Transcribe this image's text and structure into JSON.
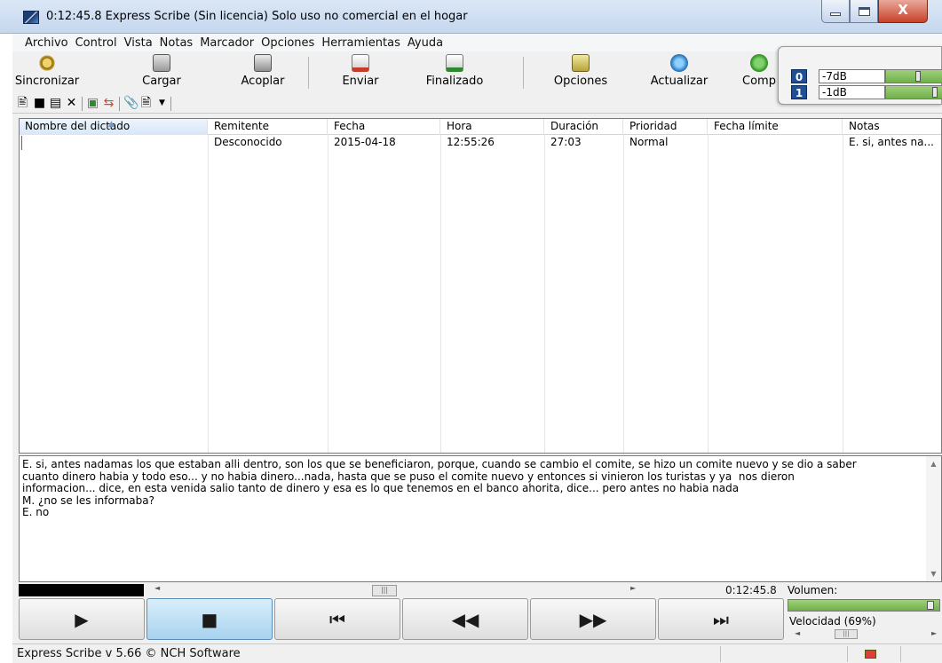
{
  "window": {
    "title": "0:12:45.8 Express Scribe (Sin licencia) Solo uso no comercial en el hogar",
    "close_glyph": "X"
  },
  "menu": [
    "Archivo",
    "Control",
    "Vista",
    "Notas",
    "Marcador",
    "Opciones",
    "Herramientas",
    "Ayuda"
  ],
  "toolbar": {
    "sync": "Sincronizar",
    "load": "Cargar",
    "dock": "Acoplar",
    "send": "Enviar",
    "finished": "Finalizado",
    "options": "Opciones",
    "update": "Actualizar",
    "comp": "Comp"
  },
  "levels": {
    "ch0": {
      "channel": "0",
      "value": "-7dB",
      "level": 0.6
    },
    "ch1": {
      "channel": "1",
      "value": "-1dB",
      "level": 0.95
    }
  },
  "table": {
    "headers": {
      "name": "Nombre del dictado",
      "sender": "Remitente",
      "date": "Fecha",
      "time": "Hora",
      "duration": "Duración",
      "priority": "Prioridad",
      "deadline": "Fecha límite",
      "notes": "Notas"
    },
    "row": {
      "name": "",
      "sender": "Desconocido",
      "date": "2015-04-18",
      "time": "12:55:26",
      "duration": "27:03",
      "priority": "Normal",
      "deadline": "",
      "notes": "E. si, antes na..."
    }
  },
  "notes_text": "E. si, antes nadamas los que estaban alli dentro, son los que se beneficiaron, porque, cuando se cambio el comite, se hizo un comite nuevo y se dio a saber\ncuanto dinero habia y todo eso... y no habia dinero...nada, hasta que se puso el comite nuevo y entonces si vinieron los turistas y ya  nos dieron\ninformacion... dice, en esta venida salio tanto de dinero y esa es lo que tenemos en el banco ahorita, dice... pero antes no habia nada\nM. ¿no se les informaba?\nE. no",
  "playback": {
    "position": "0:12:45.8",
    "volume_label": "Volumen:",
    "speed_label": "Velocidad (69%)",
    "speed": 0.69
  },
  "status": {
    "text": "Express Scribe v 5.66 © NCH Software"
  }
}
